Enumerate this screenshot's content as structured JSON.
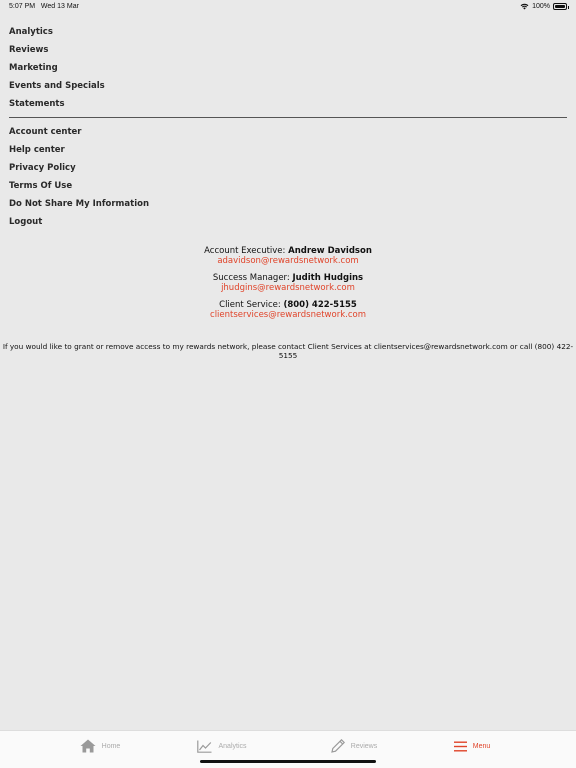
{
  "status_bar": {
    "time": "5:07 PM",
    "date": "Wed 13 Mar",
    "battery": "100%",
    "battery_level": 1.0
  },
  "menu": {
    "primary": [
      {
        "label": "Analytics"
      },
      {
        "label": "Reviews"
      },
      {
        "label": "Marketing"
      },
      {
        "label": "Events and Specials"
      },
      {
        "label": "Statements"
      }
    ],
    "secondary": [
      {
        "label": "Account center"
      },
      {
        "label": "Help center"
      },
      {
        "label": "Privacy Policy"
      },
      {
        "label": "Terms Of Use"
      },
      {
        "label": "Do Not Share My Information"
      },
      {
        "label": "Logout"
      }
    ]
  },
  "contacts": {
    "executive": {
      "role": "Account Executive:",
      "name": "Andrew Davidson",
      "email": "adavidson@rewardsnetwork.com"
    },
    "success": {
      "role": "Success Manager:",
      "name": "Judith Hudgins",
      "email": "jhudgins@rewardsnetwork.com"
    },
    "service": {
      "role": "Client Service:",
      "name": "(800) 422-5155",
      "email": "clientservices@rewardsnetwork.com"
    }
  },
  "notice": "If you would like to grant or remove access to my rewards network, please contact Client Services at clientservices@rewardsnetwork.com or call (800) 422-5155",
  "tab_bar": {
    "tabs": [
      {
        "label": "Home",
        "icon": "home-icon"
      },
      {
        "label": "Analytics",
        "icon": "chart-icon"
      },
      {
        "label": "Reviews",
        "icon": "pencil-icon"
      },
      {
        "label": "Menu",
        "icon": "hamburger-icon"
      }
    ],
    "active": "Menu"
  },
  "colors": {
    "accent": "#e0442a",
    "background": "#e9e9e9",
    "inactive": "#aaaaaa"
  }
}
